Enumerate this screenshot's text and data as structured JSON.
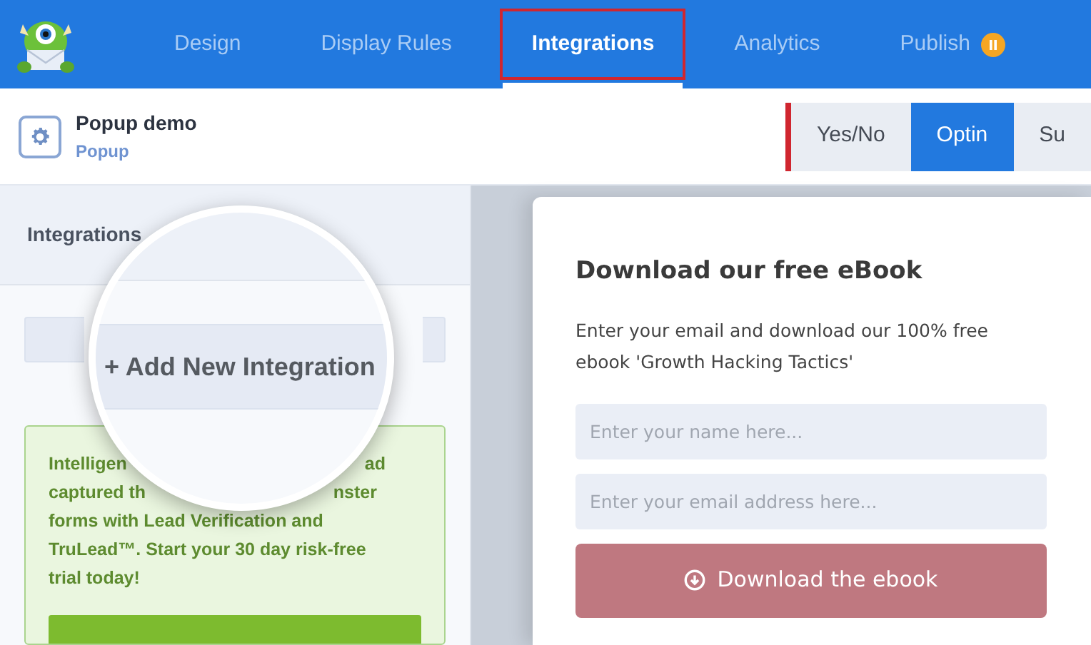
{
  "nav": {
    "tabs": [
      {
        "label": "Design",
        "selected": false,
        "highlighted": false,
        "paused": false
      },
      {
        "label": "Display Rules",
        "selected": false,
        "highlighted": false,
        "paused": false
      },
      {
        "label": "Integrations",
        "selected": true,
        "highlighted": true,
        "paused": false
      },
      {
        "label": "Analytics",
        "selected": false,
        "highlighted": false,
        "paused": false
      },
      {
        "label": "Publish",
        "selected": false,
        "highlighted": false,
        "paused": true
      }
    ]
  },
  "campaign": {
    "title": "Popup demo",
    "type": "Popup"
  },
  "views": [
    {
      "label": "Yes/No",
      "selected": false
    },
    {
      "label": "Optin",
      "selected": true
    },
    {
      "label": "Su",
      "selected": false
    }
  ],
  "sidebar": {
    "title": "Integrations",
    "add_button": "+ Add New Integration",
    "promo_fragments": [
      "Intelligen",
      "ad",
      "captured th",
      "nster"
    ],
    "promo_text": "forms with Lead Verification and TruLead™. Start your 30 day risk-free trial today!"
  },
  "popup": {
    "title": "Download our free eBook",
    "text": "Enter your email and download our 100% free ebook 'Growth Hacking Tactics'",
    "fields": [
      {
        "placeholder": "Enter your name here..."
      },
      {
        "placeholder": "Enter your email address here..."
      }
    ],
    "button": "Download the ebook"
  }
}
